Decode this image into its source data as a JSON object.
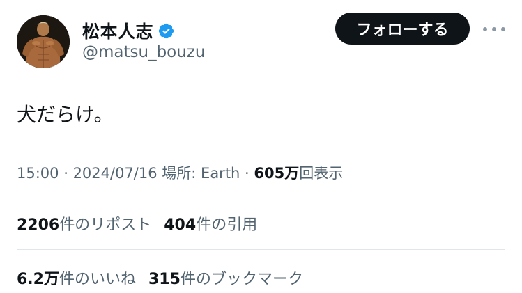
{
  "author": {
    "display_name": "松本人志",
    "handle": "@matsu_bouzu",
    "verified": true,
    "avatar_icon": "muscle-figure-avatar"
  },
  "follow_button": {
    "label": "フォローする"
  },
  "more_menu": {
    "icon": "more-horizontal-icon"
  },
  "tweet": {
    "text": "犬だらけ。"
  },
  "meta": {
    "time": "15:00",
    "separator1": " · ",
    "date": "2024/07/16",
    "location_label": " 場所: ",
    "location": "Earth",
    "separator2": " · ",
    "views_count": "605万",
    "views_label": "回表示"
  },
  "stats": {
    "reposts": {
      "count": "2206",
      "label": "件のリポスト"
    },
    "quotes": {
      "count": "404",
      "label": "件の引用"
    },
    "likes": {
      "count": "6.2万",
      "label": "件のいいね"
    },
    "bookmarks": {
      "count": "315",
      "label": "件のブックマーク"
    }
  },
  "colors": {
    "text_primary": "#0f1419",
    "text_secondary": "#536471",
    "verified_blue": "#1d9bf0",
    "follow_bg": "#0f1419"
  }
}
